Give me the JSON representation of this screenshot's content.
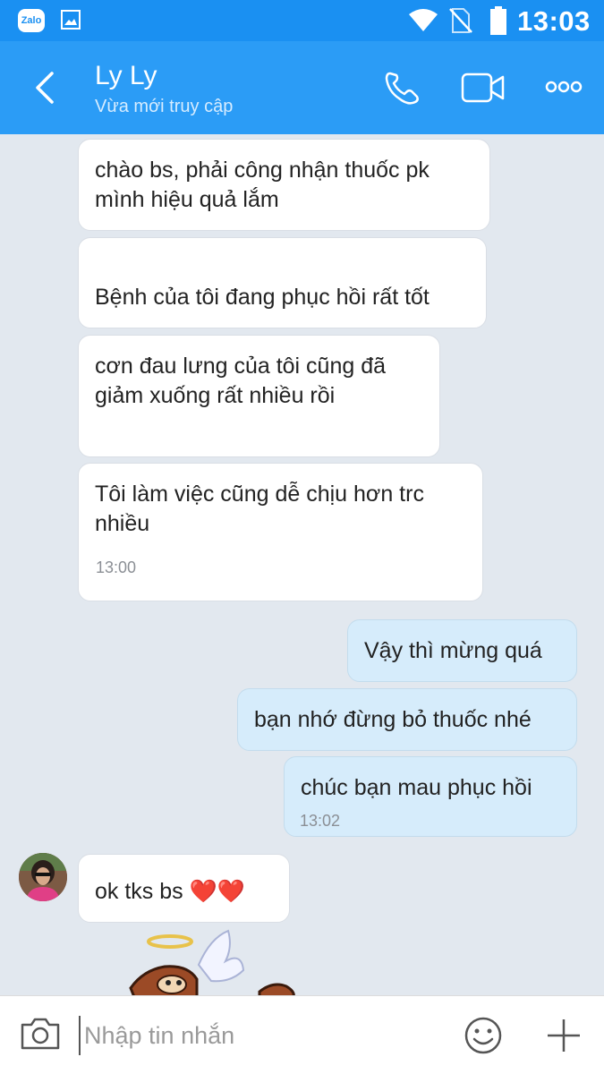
{
  "status_bar": {
    "app_icon_text": "Zalo",
    "time": "13:03"
  },
  "header": {
    "contact_name": "Ly Ly",
    "contact_status": "Vừa mới truy cập"
  },
  "messages": [
    {
      "text": "chào bs, phải công nhận thuốc pk\nmình hiệu quả lắm"
    },
    {
      "text": "Bệnh của tôi đang phục hồi rất tốt"
    },
    {
      "text": "cơn đau lưng của tôi cũng đã\ngiảm xuống rất nhiều rồi"
    },
    {
      "text": "Tôi làm việc cũng dễ chịu hơn trc\nnhiều",
      "time": "13:00"
    },
    {
      "text": "Vậy thì mừng quá"
    },
    {
      "text": "bạn nhớ đừng bỏ thuốc nhé"
    },
    {
      "text": "chúc bạn mau phục hồi",
      "time": "13:02"
    },
    {
      "text": "ok tks bs ❤️❤️"
    }
  ],
  "composer": {
    "placeholder": "Nhập tin nhắn"
  },
  "colors": {
    "header": "#2b9cf6",
    "status_bar": "#1a90f2",
    "outgoing_bubble": "#d6ecfb",
    "background": "#e2e8ef"
  },
  "icons": [
    "back-icon",
    "phone-icon",
    "video-camera-icon",
    "more-icon",
    "camera-icon",
    "emoji-icon",
    "plus-icon"
  ]
}
